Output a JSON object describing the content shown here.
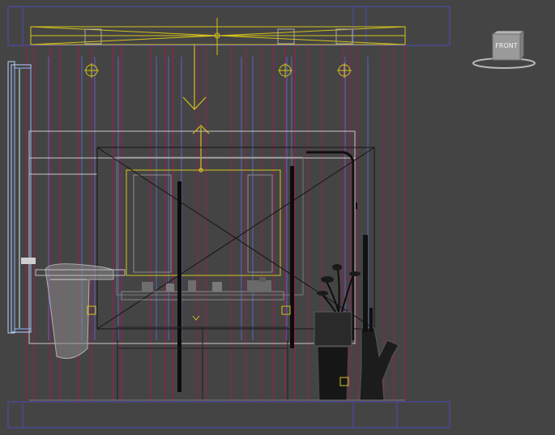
{
  "viewport": {
    "name": "front-viewport",
    "background": "#444444"
  },
  "viewcube": {
    "label": "FRONT",
    "face_color": "#9a9a9a",
    "ring_color": "#bdbdbd"
  },
  "colors": {
    "wire_blue": "#5a5acd",
    "wire_magenta": "#b0205a",
    "wire_lightblue": "#b8d4ff",
    "selected_yellow": "#d4c21a",
    "mesh_black": "#0c0c0c",
    "mesh_dark": "#2a2a2a",
    "mesh_gray": "#8c8c8c",
    "mesh_light": "#c8c8c8"
  },
  "objects": {
    "ceiling_light_fixture": "ceiling-light-fixture",
    "spot_lights": [
      "spotlight-left",
      "spotlight-center-right",
      "spotlight-right"
    ],
    "camera_target": "camera-target-arrow",
    "wall_panel": "wall-panel",
    "mirror": "mirror",
    "vanity": "vanity-cabinet",
    "towel": "towel",
    "shower_pipe": "shower-pipe",
    "plant": "potted-plant",
    "vase": "vase",
    "door": "door-frame"
  }
}
